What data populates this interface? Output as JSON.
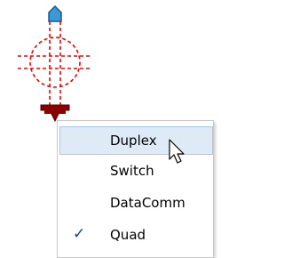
{
  "context_menu": {
    "items": [
      {
        "label": "Duplex",
        "highlighted": true,
        "checked": false
      },
      {
        "label": "Switch",
        "highlighted": false,
        "checked": false
      },
      {
        "label": "DataComm",
        "highlighted": false,
        "checked": false
      },
      {
        "label": "Quad",
        "highlighted": false,
        "checked": true
      }
    ],
    "check_glyph": "✓"
  },
  "icons": {
    "symbol": "receptacle-symbol-icon",
    "cursor": "arrow-cursor-icon",
    "check": "checkmark-icon"
  },
  "colors": {
    "symbol_red": "#ff0000",
    "symbol_dark_red": "#8b0000",
    "symbol_blue": "#3a9ad9",
    "menu_highlight": "#dfeaf7",
    "menu_highlight_border": "#a9c9ec",
    "check_color": "#1a3ea1"
  }
}
